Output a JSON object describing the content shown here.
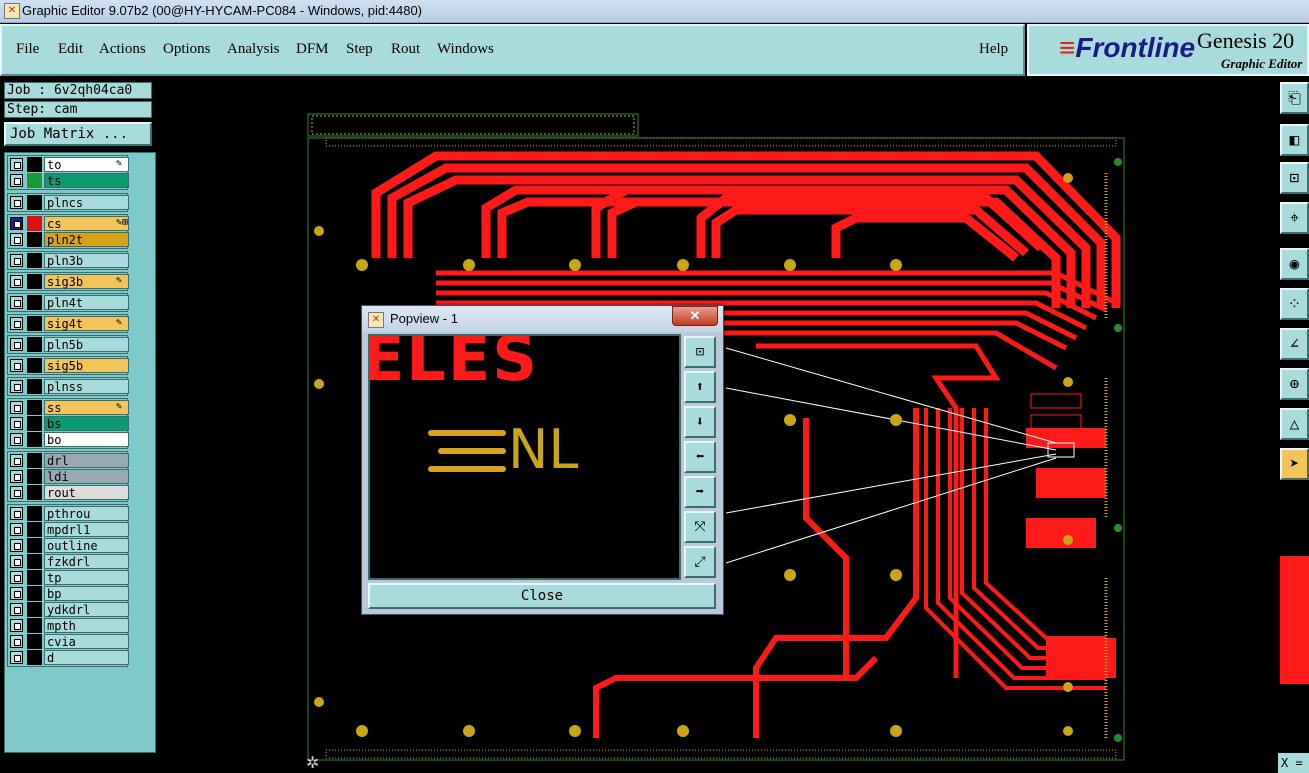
{
  "window": {
    "title": "Graphic Editor 9.07b2 (00@HY-HYCAM-PC084 - Windows, pid:4480)"
  },
  "menu": {
    "items": [
      "File",
      "Edit",
      "Actions",
      "Options",
      "Analysis",
      "DFM",
      "Step",
      "Rout",
      "Windows"
    ],
    "help": "Help"
  },
  "brand": {
    "logo": "Frontline",
    "product": "Genesis 20",
    "subtitle": "Graphic Editor"
  },
  "info": {
    "job": "Job : 6v2qh04ca0",
    "step": "Step: cam",
    "job_matrix": "Job Matrix ..."
  },
  "layers": [
    {
      "name": "to",
      "color": "#000000",
      "bg": "#ffffff",
      "mark": "✎"
    },
    {
      "name": "ts",
      "color": "#1a9a3a",
      "bg": "#0c9a72",
      "mark": ""
    },
    {
      "name": "plncs",
      "color": "#000000",
      "bg": "#a8dcdc",
      "mark": ""
    },
    {
      "name": "cs",
      "color": "#e01010",
      "bg": "#f2c45a",
      "mark": "✎⊞",
      "checkcolor": "#1a1a9a"
    },
    {
      "name": "pln2t",
      "color": "#000000",
      "bg": "#d8a21a",
      "mark": ""
    },
    {
      "name": "pln3b",
      "color": "#000000",
      "bg": "#a8dcdc",
      "mark": ""
    },
    {
      "name": "sig3b",
      "color": "#000000",
      "bg": "#f2c45a",
      "mark": "✎"
    },
    {
      "name": "pln4t",
      "color": "#000000",
      "bg": "#a8dcdc",
      "mark": ""
    },
    {
      "name": "sig4t",
      "color": "#000000",
      "bg": "#f2c45a",
      "mark": "✎"
    },
    {
      "name": "pln5b",
      "color": "#000000",
      "bg": "#a8dcdc",
      "mark": ""
    },
    {
      "name": "sig5b",
      "color": "#000000",
      "bg": "#f2c45a",
      "mark": ""
    },
    {
      "name": "plnss",
      "color": "#000000",
      "bg": "#a8dcdc",
      "mark": ""
    },
    {
      "name": "ss",
      "color": "#000000",
      "bg": "#f2c45a",
      "mark": "✎"
    },
    {
      "name": "bs",
      "color": "#000000",
      "bg": "#0c9a72",
      "mark": ""
    },
    {
      "name": "bo",
      "color": "#000000",
      "bg": "#ffffff",
      "mark": ""
    },
    {
      "name": "drl",
      "color": "#000000",
      "bg": "#9aa8b4",
      "mark": ""
    },
    {
      "name": "ldi",
      "color": "#000000",
      "bg": "#9aa8b4",
      "mark": ""
    },
    {
      "name": "rout",
      "color": "#000000",
      "bg": "#dcdcdc",
      "mark": ""
    },
    {
      "name": "pthrou",
      "color": "#000000",
      "bg": "#a8dcdc",
      "mark": ""
    },
    {
      "name": "mpdrl1",
      "color": "#000000",
      "bg": "#a8dcdc",
      "mark": ""
    },
    {
      "name": "outline",
      "color": "#000000",
      "bg": "#a8dcdc",
      "mark": ""
    },
    {
      "name": "fzkdrl",
      "color": "#000000",
      "bg": "#a8dcdc",
      "mark": ""
    },
    {
      "name": "tp",
      "color": "#000000",
      "bg": "#a8dcdc",
      "mark": ""
    },
    {
      "name": "bp",
      "color": "#000000",
      "bg": "#a8dcdc",
      "mark": ""
    },
    {
      "name": "ydkdrl",
      "color": "#000000",
      "bg": "#a8dcdc",
      "mark": ""
    },
    {
      "name": "mpth",
      "color": "#000000",
      "bg": "#a8dcdc",
      "mark": ""
    },
    {
      "name": "cvia",
      "color": "#000000",
      "bg": "#a8dcdc",
      "mark": ""
    },
    {
      "name": "d",
      "color": "#000000",
      "bg": "#a8dcdc",
      "mark": ""
    }
  ],
  "popview": {
    "title": "Popview - 1",
    "close_x": "✕",
    "close_label": "Close",
    "view_text_top": "ELES",
    "view_text_logo": "NL"
  },
  "coords": {
    "label": "X ="
  },
  "colors": {
    "panel": "#a8dcdc",
    "trace": "#ff1a1a",
    "pad": "#c8a614",
    "outline": "#2e8a2e"
  }
}
